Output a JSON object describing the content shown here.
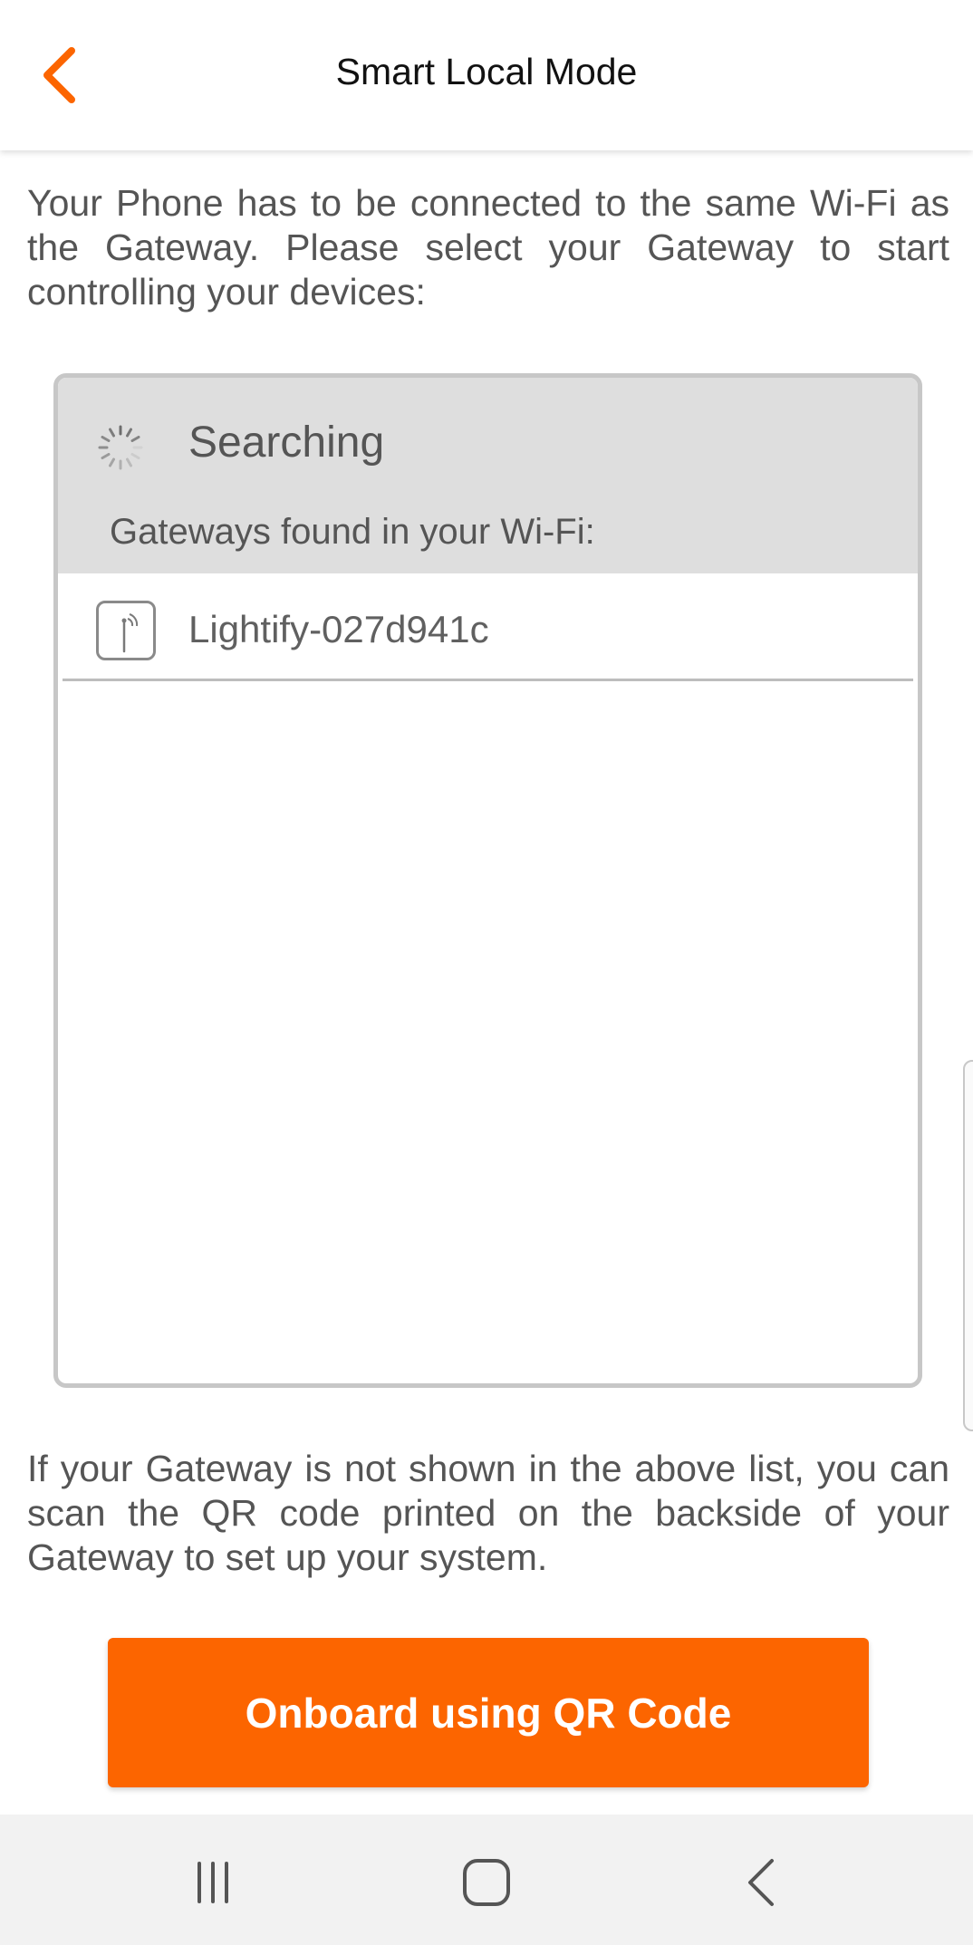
{
  "header": {
    "title": "Smart Local Mode",
    "back_icon": "chevron-left-icon",
    "accent_color": "#fc6500"
  },
  "intro_text": "Your Phone has to be connected to the same Wi-Fi as the Gateway. Please select your Gateway to start controlling your devices:",
  "search_panel": {
    "status_label": "Searching",
    "status_icon": "loading-spinner-icon",
    "found_label": "Gateways found in your Wi-Fi:",
    "gateways": [
      {
        "name": "Lightify-027d941c",
        "icon": "gateway-icon"
      }
    ]
  },
  "footer_text": "If your Gateway is not shown in the above list, you can scan the QR code printed on the backside of your Gateway to set up your system.",
  "qr_button": {
    "label": "Onboard using QR Code",
    "color": "#fc6500"
  },
  "nav_bar": {
    "recents_icon": "recents-icon",
    "home_icon": "home-icon",
    "back_icon": "back-icon"
  }
}
